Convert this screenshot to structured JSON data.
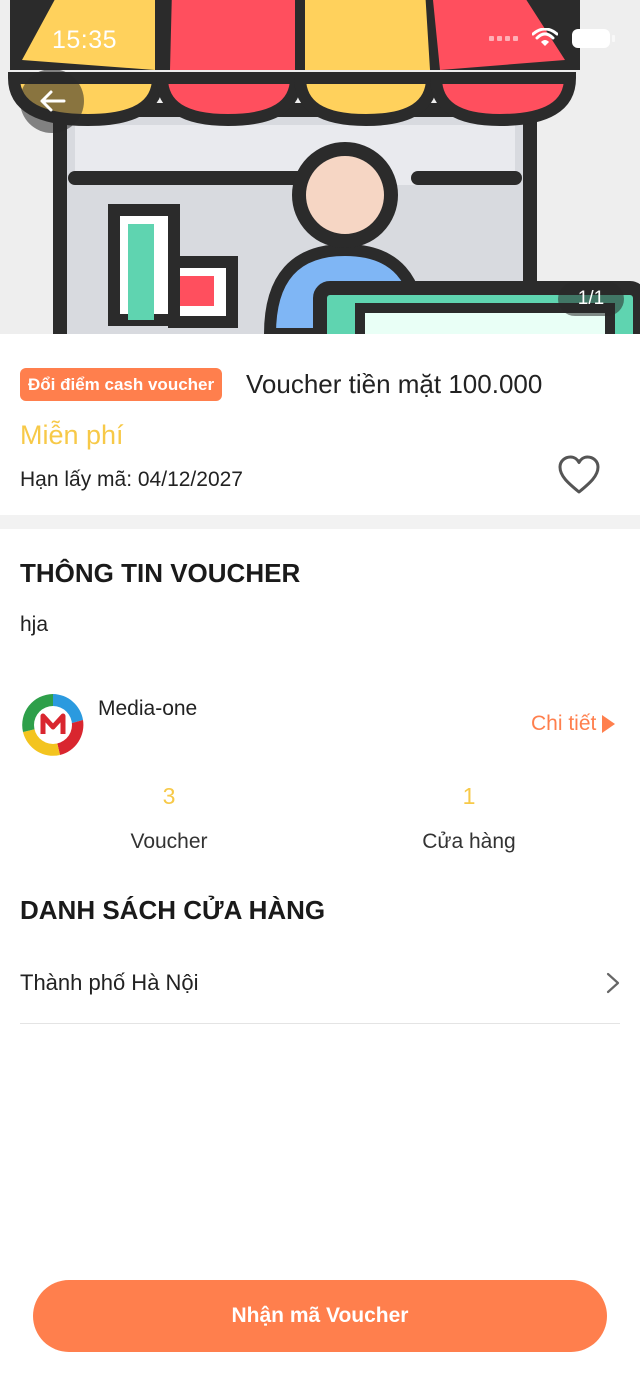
{
  "status_bar": {
    "time": "15:35"
  },
  "hero": {
    "page_counter": "1/1"
  },
  "voucher": {
    "badge": "Đổi điểm cash voucher",
    "title": "Voucher tiền mặt 100.000",
    "price": "Miễn phí",
    "expiry": "Hạn lấy mã: 04/12/2027"
  },
  "info_section": {
    "title": "THÔNG TIN VOUCHER",
    "description": "hja"
  },
  "merchant": {
    "name": "Media-one",
    "detail_link": "Chi tiết",
    "stats": [
      {
        "value": "3",
        "label": "Voucher"
      },
      {
        "value": "1",
        "label": "Cửa hàng"
      }
    ]
  },
  "stores_section": {
    "title": "DANH SÁCH CỬA HÀNG",
    "stores": [
      {
        "name": "Thành phố Hà Nội"
      }
    ]
  },
  "cta": {
    "label": "Nhận mã Voucher"
  },
  "colors": {
    "accent": "#ff7f4d",
    "price_yellow": "#f7c948",
    "awning_yellow": "#ffd15c",
    "awning_red": "#ff4f5e"
  }
}
